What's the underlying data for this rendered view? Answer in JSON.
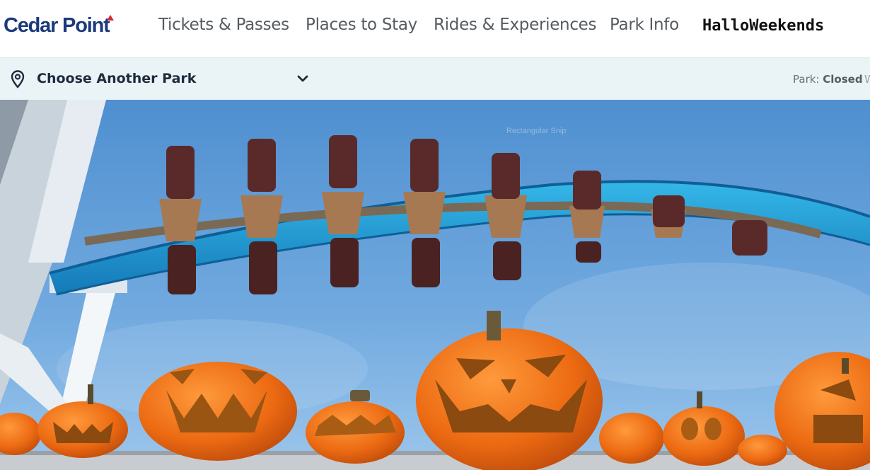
{
  "nav": {
    "logo_text": "Cedar Point",
    "items": [
      {
        "label": "Tickets & Passes"
      },
      {
        "label": "Places to Stay"
      },
      {
        "label": "Rides & Experiences"
      },
      {
        "label": "Park Info"
      },
      {
        "label": "HalloWeekends"
      }
    ]
  },
  "park_bar": {
    "selector_label": "Choose Another Park",
    "status_prefix": "Park:",
    "status_value": "Closed",
    "status_more": "W"
  },
  "hero": {
    "caption": "Rectangular Snip",
    "colors": {
      "sky": "#5e9bd6",
      "track": "#1f9fd6",
      "pumpkin": "#f07a1e"
    }
  }
}
